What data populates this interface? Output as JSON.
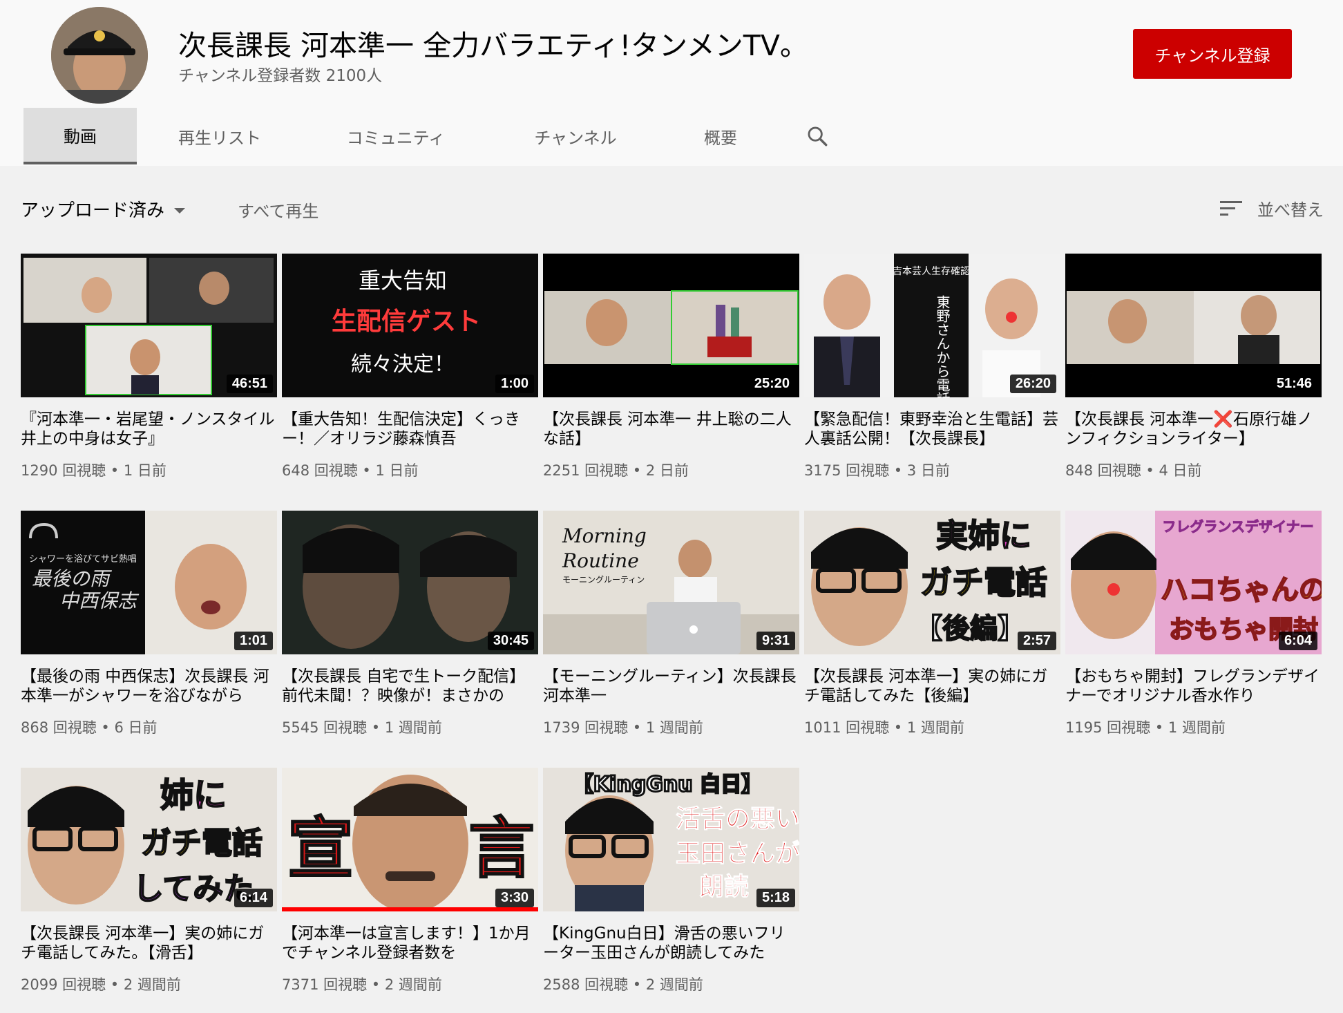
{
  "channel": {
    "name": "次長課長 河本準一 全力バラエティ!タンメンTV。",
    "subscribers": "チャンネル登録者数 2100人",
    "subscribe_label": "チャンネル登録"
  },
  "tabs": [
    {
      "label": "動画"
    },
    {
      "label": "再生リスト"
    },
    {
      "label": "コミュニティ"
    },
    {
      "label": "チャンネル"
    },
    {
      "label": "概要"
    }
  ],
  "sortbar": {
    "uploads_label": "アップロード済み",
    "play_all": "すべて再生",
    "sort_label": "並べ替え"
  },
  "videos": [
    {
      "title": "『河本準一・岩尾望・ノンスタイル井上の中身は女子』",
      "meta": "1290 回視聴 • 1 日前",
      "duration": "46:51"
    },
    {
      "title": "【重大告知！生配信決定】くっきー！／オリラジ藤森慎吾",
      "meta": "648 回視聴 • 1 日前",
      "duration": "1:00"
    },
    {
      "title": "【次長課長 河本準一 井上聡の二人な話】",
      "meta": "2251 回視聴 • 2 日前",
      "duration": "25:20"
    },
    {
      "title": "【緊急配信！東野幸治と生電話】芸人裏話公開！【次長課長】",
      "meta": "3175 回視聴 • 3 日前",
      "duration": "26:20"
    },
    {
      "title": "【次長課長 河本準一❌石原行雄ノンフィクションライター】",
      "meta": "848 回視聴 • 4 日前",
      "duration": "51:46"
    },
    {
      "title": "【最後の雨 中西保志】次長課長 河本準一がシャワーを浴びながら",
      "meta": "868 回視聴 • 6 日前",
      "duration": "1:01"
    },
    {
      "title": "【次長課長 自宅で生トーク配信】前代未聞！？映像が！まさかの",
      "meta": "5545 回視聴 • 1 週間前",
      "duration": "30:45"
    },
    {
      "title": "【モーニングルーティン】次長課長 河本準一",
      "meta": "1739 回視聴 • 1 週間前",
      "duration": "9:31"
    },
    {
      "title": "【次長課長 河本準一】実の姉にガチ電話してみた【後編】",
      "meta": "1011 回視聴 • 1 週間前",
      "duration": "2:57"
    },
    {
      "title": "【おもちゃ開封】フレグランデザイナーでオリジナル香水作り",
      "meta": "1195 回視聴 • 1 週間前",
      "duration": "6:04"
    },
    {
      "title": "【次長課長 河本準一】実の姉にガチ電話してみた。【滑舌】",
      "meta": "2099 回視聴 • 2 週間前",
      "duration": "6:14"
    },
    {
      "title": "【河本準一は宣言します！】1か月でチャンネル登録者数を",
      "meta": "7371 回視聴 • 2 週間前",
      "duration": "3:30"
    },
    {
      "title": "【KingGnu白日】滑舌の悪いフリーター玉田さんが朗読してみた",
      "meta": "2588 回視聴 • 2 週間前",
      "duration": "5:18"
    }
  ],
  "thumb_text": {
    "t2_line1": "重大告知",
    "t2_line2": "生配信ゲスト",
    "t2_line3": "続々決定！",
    "t4_vertical": "東野さんから電話がきた",
    "t6_small": "シャワーを浴びてサビ熱唱",
    "t6_line1": "最後の雨",
    "t6_line2": "中西保志",
    "t8_line1": "Morning",
    "t8_line2": "Routine",
    "t8_sub": "モーニングルーティン",
    "t9_line1": "実姉に",
    "t9_line2": "ガチ電話",
    "t9_line3": "【後編】",
    "t10_top": "フレグランスデザイナー",
    "t10_line1": "ハコちゃんの",
    "t10_line2": "おもちゃ開封",
    "t11_line1": "姉に",
    "t11_line2": "ガチ電話",
    "t11_line3": "してみた",
    "t12_left": "宣",
    "t12_right": "言",
    "t13_line1": "【KingGnu 白日】",
    "t13_line2": "活舌の悪い",
    "t13_line3": "玉田さんが",
    "t13_line4": "朗読"
  },
  "colors": {
    "subscribe": "#cc0000",
    "progress": "#ff0000"
  }
}
